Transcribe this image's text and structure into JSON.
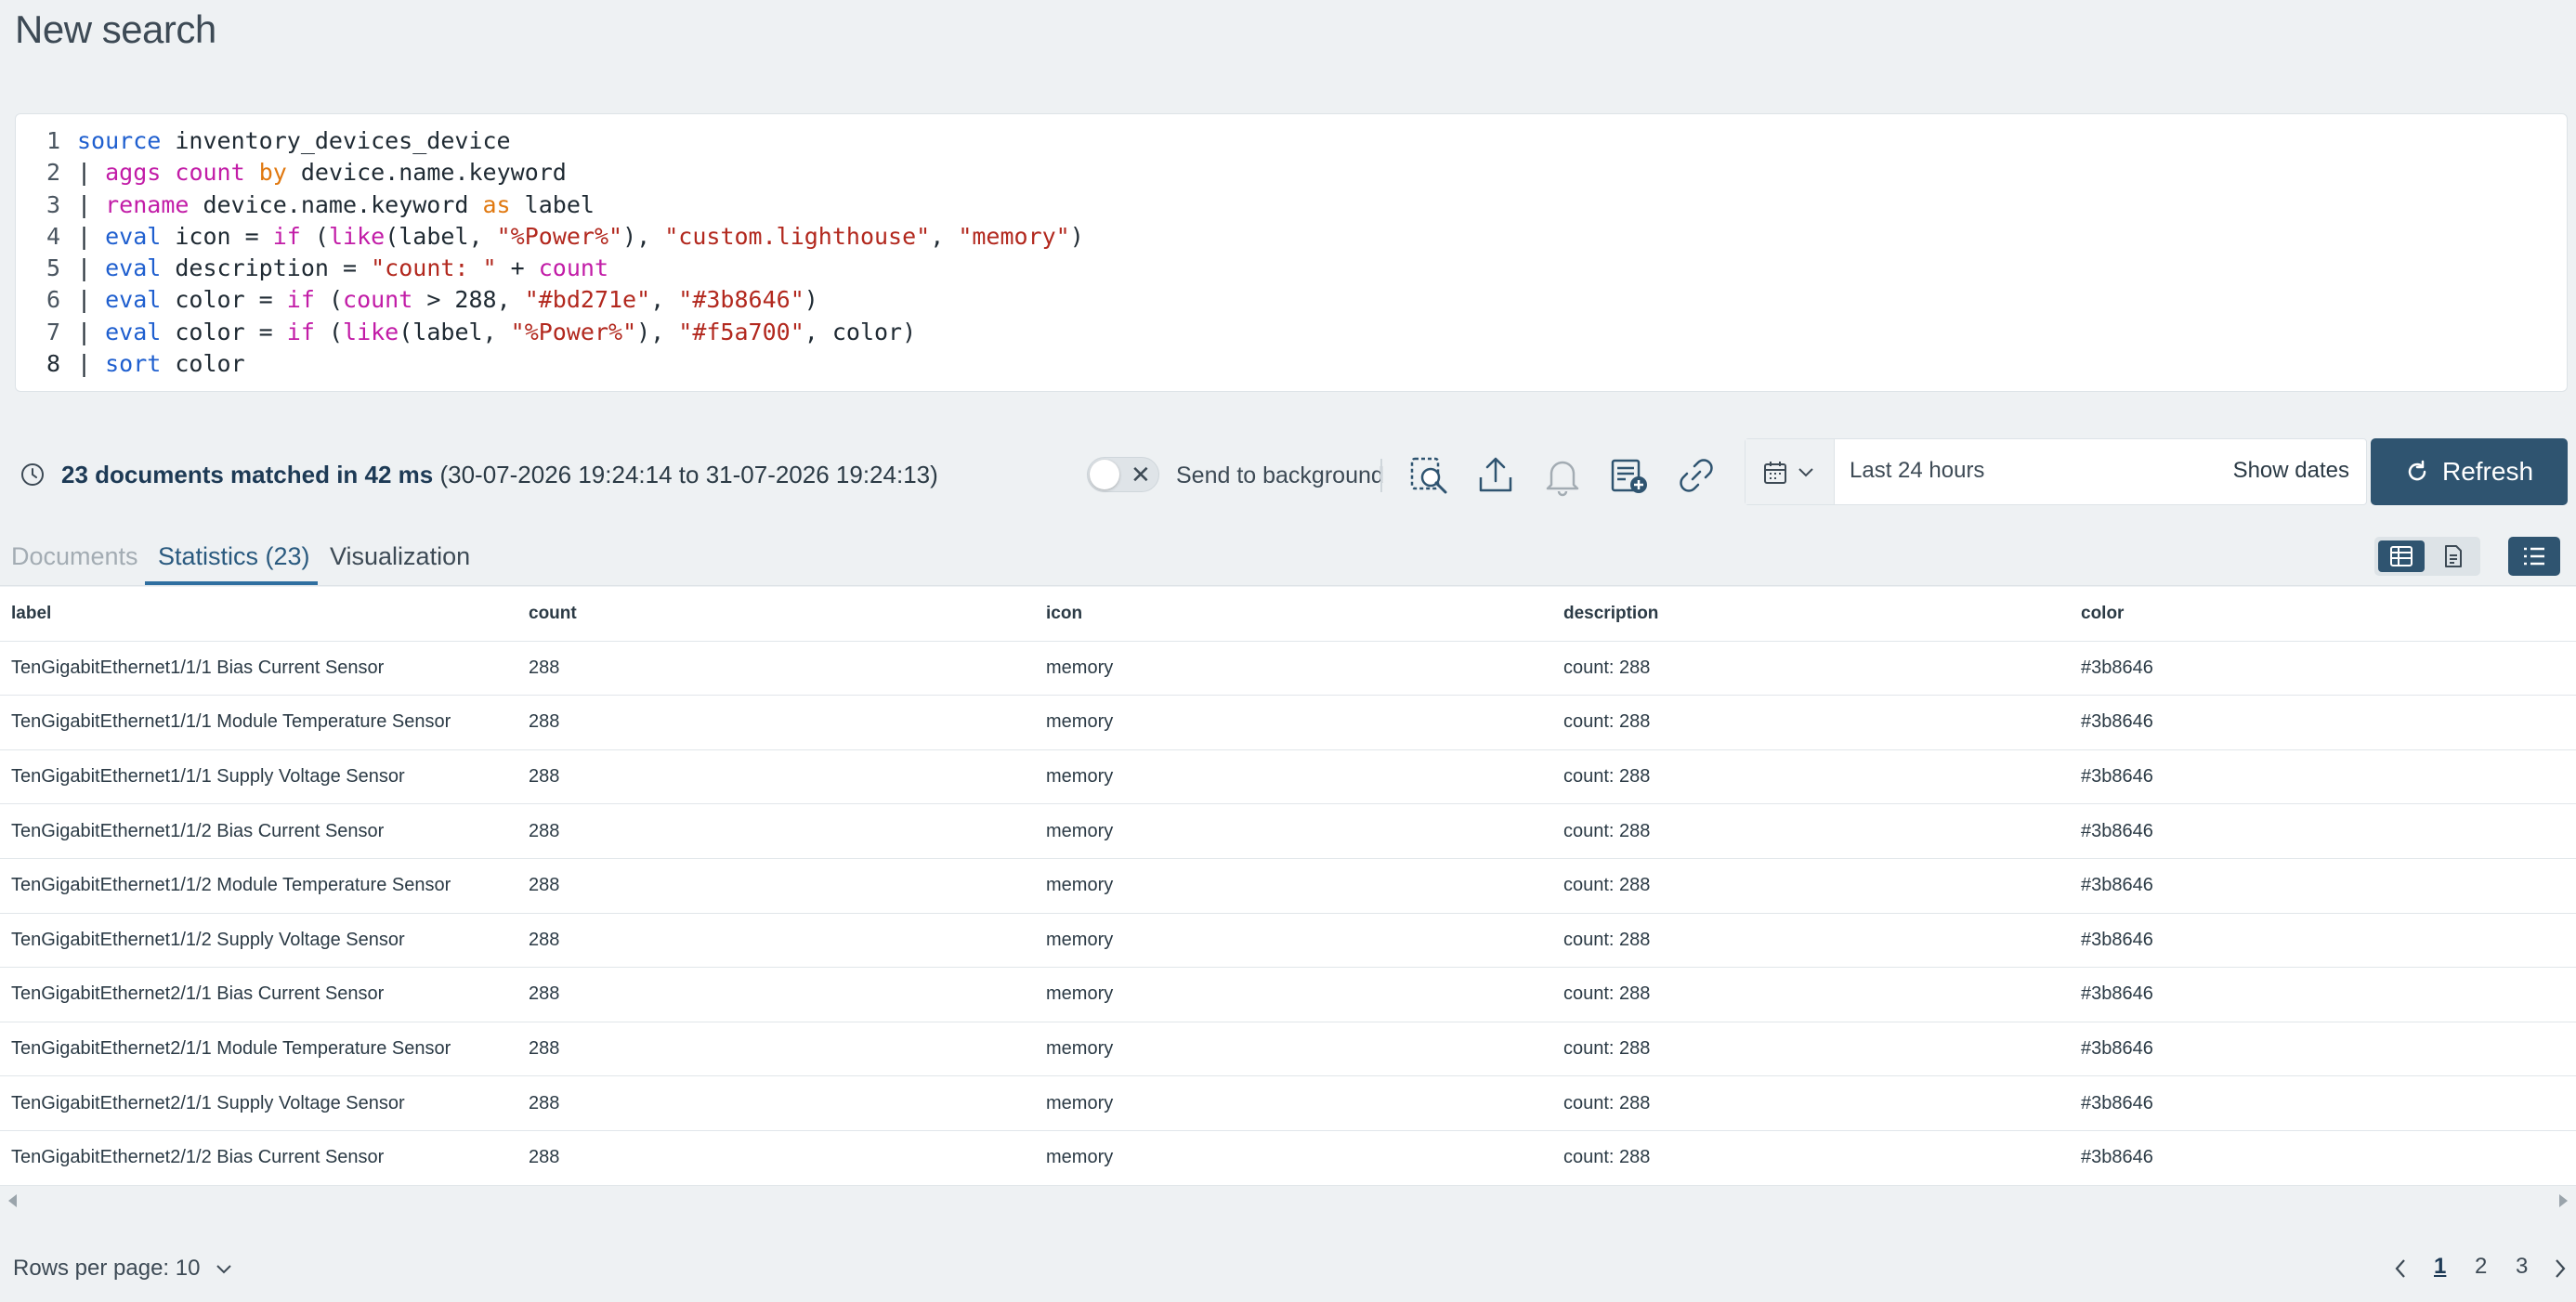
{
  "page": {
    "title": "New search"
  },
  "editor": {
    "lines": [
      {
        "n": "1",
        "tokens": [
          [
            "kw",
            "source"
          ],
          [
            "id",
            " inventory_devices_device"
          ]
        ]
      },
      {
        "n": "2",
        "tokens": [
          [
            "id",
            "| "
          ],
          [
            "fn",
            "aggs"
          ],
          [
            "id",
            " "
          ],
          [
            "fn",
            "count"
          ],
          [
            "id",
            " "
          ],
          [
            "op",
            "by"
          ],
          [
            "id",
            " device.name.keyword"
          ]
        ]
      },
      {
        "n": "3",
        "tokens": [
          [
            "id",
            "| "
          ],
          [
            "fn",
            "rename"
          ],
          [
            "id",
            " device.name.keyword "
          ],
          [
            "op",
            "as"
          ],
          [
            "id",
            " label"
          ]
        ]
      },
      {
        "n": "4",
        "tokens": [
          [
            "id",
            "| "
          ],
          [
            "kw",
            "eval"
          ],
          [
            "id",
            " icon = "
          ],
          [
            "fn",
            "if"
          ],
          [
            "id",
            " ("
          ],
          [
            "fn",
            "like"
          ],
          [
            "id",
            "(label, "
          ],
          [
            "str",
            "\"%Power%\""
          ],
          [
            "id",
            "), "
          ],
          [
            "str",
            "\"custom.lighthouse\""
          ],
          [
            "id",
            ", "
          ],
          [
            "str",
            "\"memory\""
          ],
          [
            "id",
            ")"
          ]
        ]
      },
      {
        "n": "5",
        "tokens": [
          [
            "id",
            "| "
          ],
          [
            "kw",
            "eval"
          ],
          [
            "id",
            " description = "
          ],
          [
            "str",
            "\"count: \""
          ],
          [
            "id",
            " + "
          ],
          [
            "fn",
            "count"
          ]
        ]
      },
      {
        "n": "6",
        "tokens": [
          [
            "id",
            "| "
          ],
          [
            "kw",
            "eval"
          ],
          [
            "id",
            " color = "
          ],
          [
            "fn",
            "if"
          ],
          [
            "id",
            " ("
          ],
          [
            "fn",
            "count"
          ],
          [
            "id",
            " > 288, "
          ],
          [
            "str",
            "\"#bd271e\""
          ],
          [
            "id",
            ", "
          ],
          [
            "str",
            "\"#3b8646\""
          ],
          [
            "id",
            ")"
          ]
        ]
      },
      {
        "n": "7",
        "tokens": [
          [
            "id",
            "| "
          ],
          [
            "kw",
            "eval"
          ],
          [
            "id",
            " color = "
          ],
          [
            "fn",
            "if"
          ],
          [
            "id",
            " ("
          ],
          [
            "fn",
            "like"
          ],
          [
            "id",
            "(label, "
          ],
          [
            "str",
            "\"%Power%\""
          ],
          [
            "id",
            "), "
          ],
          [
            "str",
            "\"#f5a700\""
          ],
          [
            "id",
            ", color)"
          ]
        ]
      },
      {
        "n": "8",
        "tokens": [
          [
            "id",
            "| "
          ],
          [
            "kw",
            "sort"
          ],
          [
            "id",
            " color"
          ]
        ]
      }
    ]
  },
  "status": {
    "matched": "23 documents matched in 42 ms",
    "range": " (30-07-2026 19:24:14 to 31-07-2026 19:24:13)",
    "send_to_background": "Send to background"
  },
  "date_picker": {
    "range": "Last 24 hours",
    "show_dates": "Show dates"
  },
  "refresh_label": "Refresh",
  "tabs": {
    "documents": "Documents",
    "statistics": "Statistics (23)",
    "visualization": "Visualization"
  },
  "table": {
    "columns": [
      "label",
      "count",
      "icon",
      "description",
      "color"
    ],
    "rows": [
      [
        "TenGigabitEthernet1/1/1 Bias Current Sensor",
        "288",
        "memory",
        "count: 288",
        "#3b8646"
      ],
      [
        "TenGigabitEthernet1/1/1 Module Temperature Sensor",
        "288",
        "memory",
        "count: 288",
        "#3b8646"
      ],
      [
        "TenGigabitEthernet1/1/1 Supply Voltage Sensor",
        "288",
        "memory",
        "count: 288",
        "#3b8646"
      ],
      [
        "TenGigabitEthernet1/1/2 Bias Current Sensor",
        "288",
        "memory",
        "count: 288",
        "#3b8646"
      ],
      [
        "TenGigabitEthernet1/1/2 Module Temperature Sensor",
        "288",
        "memory",
        "count: 288",
        "#3b8646"
      ],
      [
        "TenGigabitEthernet1/1/2 Supply Voltage Sensor",
        "288",
        "memory",
        "count: 288",
        "#3b8646"
      ],
      [
        "TenGigabitEthernet2/1/1 Bias Current Sensor",
        "288",
        "memory",
        "count: 288",
        "#3b8646"
      ],
      [
        "TenGigabitEthernet2/1/1 Module Temperature Sensor",
        "288",
        "memory",
        "count: 288",
        "#3b8646"
      ],
      [
        "TenGigabitEthernet2/1/1 Supply Voltage Sensor",
        "288",
        "memory",
        "count: 288",
        "#3b8646"
      ],
      [
        "TenGigabitEthernet2/1/2 Bias Current Sensor",
        "288",
        "memory",
        "count: 288",
        "#3b8646"
      ]
    ]
  },
  "footer": {
    "rows_per_page": "Rows per page: 10",
    "pages": [
      "1",
      "2",
      "3"
    ],
    "current_page": "1"
  },
  "colors": {
    "accent": "#2f5470",
    "tab_active": "#2a5a7f"
  },
  "icons": [
    "clock-icon",
    "inspect-icon",
    "share-icon",
    "bell-icon",
    "add-report-icon",
    "link-icon",
    "calendar-icon",
    "refresh-icon",
    "table-view-icon",
    "document-view-icon",
    "list-view-icon",
    "chevron-down-icon",
    "chevron-left-icon",
    "chevron-right-icon"
  ]
}
